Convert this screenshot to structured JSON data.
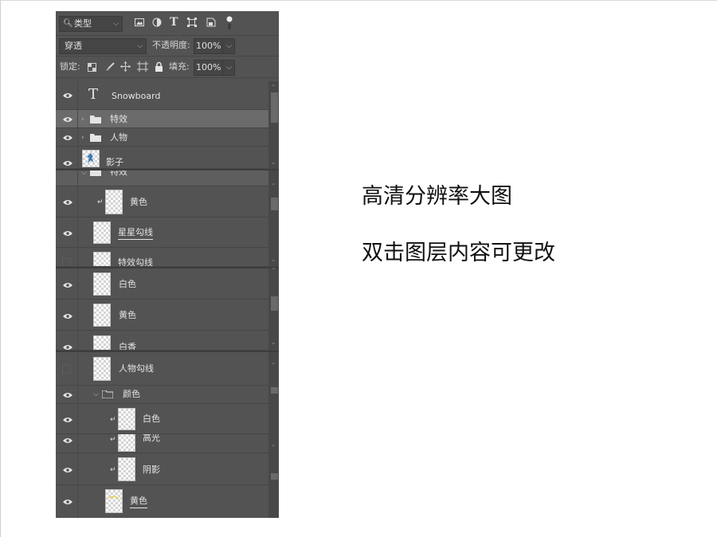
{
  "toolbar": {
    "filter_kind": "类型",
    "blend_mode": "穿透",
    "opacity_label": "不透明度:",
    "opacity_value": "100%",
    "lock_label": "锁定:",
    "fill_label": "填充:",
    "fill_value": "100%"
  },
  "layers_top": [
    {
      "name": "Snowboard",
      "type": "text",
      "visible": true
    },
    {
      "name": "特效",
      "type": "group",
      "visible": true,
      "selected": true
    },
    {
      "name": "人物",
      "type": "group",
      "visible": true
    },
    {
      "name": "影子",
      "type": "image",
      "visible": true
    }
  ],
  "layers_mid": [
    {
      "name": "特效",
      "type": "group",
      "visible": true
    },
    {
      "name": "黄色",
      "type": "clipped",
      "visible": true
    },
    {
      "name": "星星勾线",
      "type": "layer",
      "visible": true
    },
    {
      "name": "特效勾线",
      "type": "layer",
      "visible": false
    }
  ],
  "layers_third": [
    {
      "name": "白色",
      "type": "layer",
      "visible": true
    },
    {
      "name": "黄色",
      "type": "layer",
      "visible": true
    },
    {
      "name": "白香",
      "type": "layer",
      "visible": true
    }
  ],
  "layers_bottom": [
    {
      "name": "人物勾线",
      "type": "layer",
      "visible": false
    },
    {
      "name": "颜色",
      "type": "group",
      "visible": true
    },
    {
      "name": "白色",
      "type": "clipped",
      "visible": true
    },
    {
      "name": "高光",
      "type": "clipped",
      "visible": true
    },
    {
      "name": "阴影",
      "type": "clipped",
      "visible": true
    },
    {
      "name": "黄色",
      "type": "layer",
      "visible": true
    }
  ],
  "captions": {
    "line1": "高清分辨率大图",
    "line2": "双击图层内容可更改"
  },
  "colors": {
    "panel_bg": "#535353",
    "selected_row": "#6b6b6b",
    "caption_text": "#111111"
  }
}
